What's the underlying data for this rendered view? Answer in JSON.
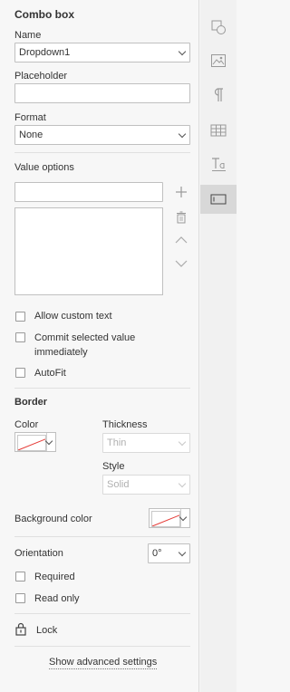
{
  "panel": {
    "title": "Combo box",
    "name": {
      "label": "Name",
      "value": "Dropdown1"
    },
    "placeholder": {
      "label": "Placeholder",
      "value": ""
    },
    "format": {
      "label": "Format",
      "value": "None"
    },
    "value_options": {
      "label": "Value options",
      "new_value": ""
    },
    "checkboxes": {
      "allow_custom_text": "Allow custom text",
      "commit_line1": "Commit selected value",
      "commit_line2": "immediately",
      "autofit": "AutoFit"
    },
    "border": {
      "title": "Border",
      "color_label": "Color",
      "thickness_label": "Thickness",
      "thickness_value": "Thin",
      "style_label": "Style",
      "style_value": "Solid"
    },
    "background": {
      "label": "Background color"
    },
    "orientation": {
      "label": "Orientation",
      "value": "0°"
    },
    "required": "Required",
    "read_only": "Read only",
    "lock": "Lock",
    "advanced": "Show advanced settings"
  },
  "rail": {
    "items": [
      "shape-icon",
      "image-icon",
      "paragraph-icon",
      "table-icon",
      "text-art-icon",
      "form-field-icon"
    ],
    "active": "form-field-icon"
  },
  "colors": {
    "accent_line": "#e53935",
    "active_rail": "#d8d8d8"
  }
}
